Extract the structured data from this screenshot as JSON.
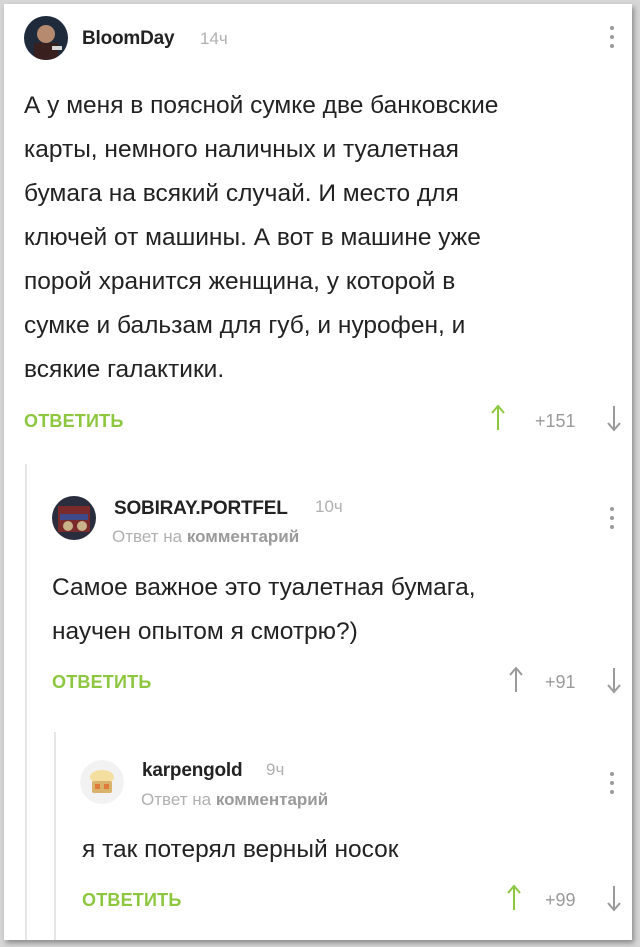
{
  "comments": [
    {
      "username": "BloomDay",
      "time": "14ч",
      "reply_to": null,
      "text": "А у меня в поясной сумке две банковские\nкарты, немного наличных и туалетная\nбумага на всякий случай. И место для\nключей от машины. А вот в машине уже\nпорой хранится женщина, у которой в\nсумке и бальзам для губ, и нурофен, и\nвсякие галактики.",
      "reply_label": "ОТВЕТИТЬ",
      "score": "+151",
      "arrow_up_color": "#8dc63f"
    },
    {
      "username": "SOBIRAY.PORTFEL",
      "time": "10ч",
      "reply_to": {
        "prefix": "Ответ на",
        "target": "комментарий"
      },
      "text": "Самое важное это туалетная бумага,\nнаучен опытом я смотрю?)",
      "reply_label": "ОТВЕТИТЬ",
      "score": "+91",
      "arrow_up_color": "#9a9a9a"
    },
    {
      "username": "karpengold",
      "time": "9ч",
      "reply_to": {
        "prefix": "Ответ на",
        "target": "комментарий"
      },
      "text": "я так потерял верный носок",
      "reply_label": "ОТВЕТИТЬ",
      "score": "+99",
      "arrow_up_color": "#8dc63f"
    }
  ],
  "colors": {
    "accent": "#8dc63f",
    "muted": "#b0b0b0",
    "text": "#222222"
  }
}
